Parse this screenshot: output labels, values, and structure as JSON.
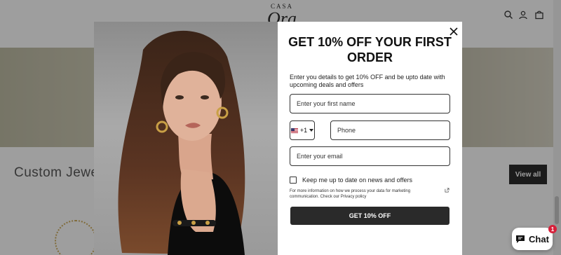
{
  "brand": {
    "logo_top": "CASA",
    "logo_main": "Ora"
  },
  "header": {
    "icons": [
      "search-icon",
      "account-icon",
      "cart-icon"
    ]
  },
  "page": {
    "section_title": "Custom Jewel",
    "view_all_label": "View all"
  },
  "modal": {
    "title": "GET 10% OFF YOUR FIRST ORDER",
    "description": "Enter you details to get 10% OFF and be upto date with upcoming deals and offers",
    "first_name_placeholder": "Enter your first name",
    "country_code": "+1",
    "phone_placeholder": "Phone",
    "email_placeholder": "Enter your email",
    "consent_label": "Keep me up to date on news and offers",
    "privacy_note": "For more information on how we process your data for marketing communication. Check our Privacy policy",
    "cta_label": "GET 10% OFF"
  },
  "chat": {
    "label": "Chat",
    "badge_count": "1"
  },
  "colors": {
    "overlay": "#282828",
    "cta_background": "#2a2a2a",
    "badge": "#d6203a",
    "view_all_background": "#111111"
  }
}
